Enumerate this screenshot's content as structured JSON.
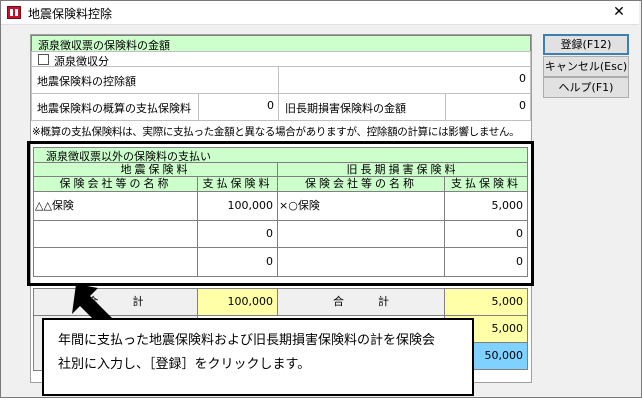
{
  "window": {
    "title": "地震保険料控除",
    "close": "✕"
  },
  "buttons": {
    "register": "登録(F12)",
    "cancel": "キャンセル(Esc)",
    "help": "ヘルプ(F1)"
  },
  "withholding": {
    "header": "源泉徴収票の保険料の金額",
    "checkbox_label": "源泉徴収分",
    "deduction_label": "地震保険料の控除額",
    "deduction_value": "0",
    "payment_label": "地震保険料の概算の支払保険料",
    "payment_value": "0",
    "old_label": "旧長期損害保険料の金額",
    "old_value": "0"
  },
  "note": "※概算の支払保険料は、実際に支払った金額と異なる場合がありますが、控除額の計算には影響しません。",
  "other": {
    "header": "源泉徴収票以外の保険料の支払い",
    "quake_header": "地震保険料",
    "old_header": "旧長期損害保険料",
    "company_col": "保険会社等の名称",
    "paid_col": "支払保険料",
    "rows": [
      {
        "quake_company": "△△保険",
        "quake_amount": "100,000",
        "old_company": "×○保険",
        "old_amount": "5,000"
      },
      {
        "quake_company": "",
        "quake_amount": "0",
        "old_company": "",
        "old_amount": "0"
      },
      {
        "quake_company": "",
        "quake_amount": "0",
        "old_company": "",
        "old_amount": "0"
      }
    ]
  },
  "totals": {
    "label": "合計",
    "quake_total": "100,000",
    "old_total": "5,000",
    "old_total2": "5,000",
    "grand_total": "50,000"
  },
  "callout": {
    "line1": "年間に支払った地震保険料および旧長期損害保険料の計を保険会",
    "line2": "社別に入力し、［登録］をクリックします。"
  }
}
